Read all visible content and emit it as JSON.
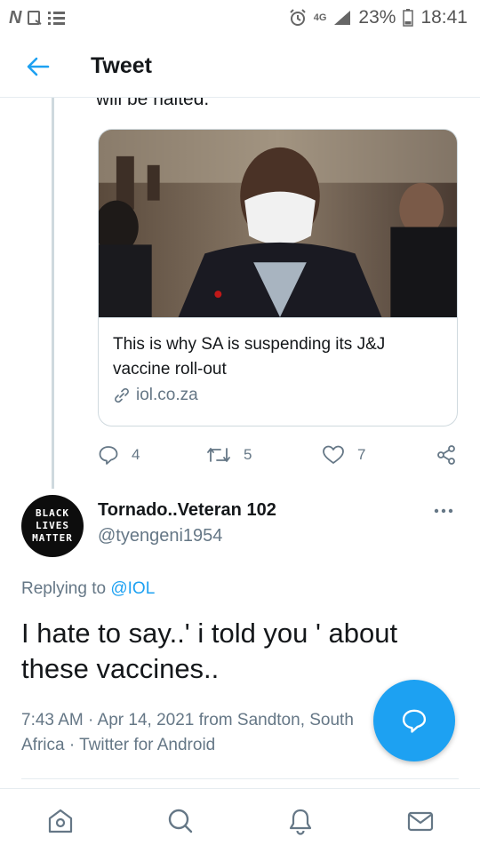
{
  "status_bar": {
    "network": "4G",
    "battery": "23%",
    "time": "18:41"
  },
  "header": {
    "title": "Tweet",
    "back_icon": "arrow-left-icon"
  },
  "quoted": {
    "clipped_text": "will be halted."
  },
  "card": {
    "title": "This is why SA is suspending its J&J vaccine roll-out",
    "domain": "iol.co.za"
  },
  "actions": {
    "replies": "4",
    "retweets": "5",
    "likes": "7"
  },
  "tweet": {
    "avatar_text": [
      "BLACK",
      "LIVES",
      "MATTER"
    ],
    "name": "Tornado..Veteran 102",
    "handle": "@tyengeni1954",
    "replying_prefix": "Replying to",
    "replying_mention": "@IOL",
    "text": "I hate to say..' i told you ' about these vaccines..",
    "meta": "7:43 AM · Apr 14, 2021 from Sandton, South Africa · Twitter for Android"
  },
  "colors": {
    "accent": "#1da1f2",
    "muted": "#657786",
    "text": "#14171a"
  }
}
